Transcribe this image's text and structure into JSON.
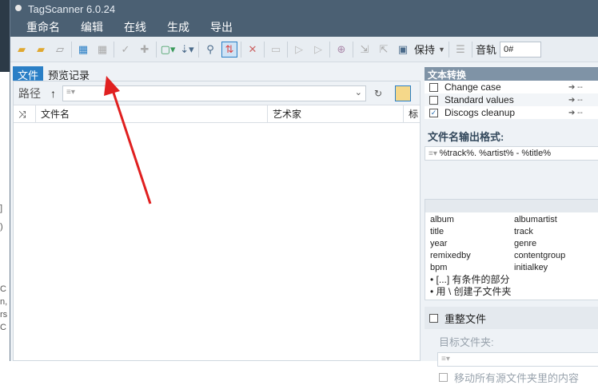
{
  "window": {
    "title": "TagScanner 6.0.24"
  },
  "menu": [
    "重命名",
    "编辑",
    "在线",
    "生成",
    "导出"
  ],
  "toolbar": {
    "keep_label": "保持",
    "track_label": "音轨",
    "track_value": "0#"
  },
  "tabs": [
    {
      "label": "文件"
    },
    {
      "label": "预览记录"
    }
  ],
  "path": {
    "label": "路径",
    "placeholder": "≡▾"
  },
  "columns": [
    "文件名",
    "艺术家",
    "标"
  ],
  "text_conversion": {
    "title": "文本转换",
    "options": [
      {
        "label": "Change case",
        "checked": false
      },
      {
        "label": "Standard values",
        "checked": false
      },
      {
        "label": "Discogs cleanup",
        "checked": true
      }
    ],
    "arrow_value": "--"
  },
  "format": {
    "label": "文件名输出格式:",
    "value": "%track%. %artist% - %title%"
  },
  "fields": [
    "album",
    "albumartist",
    "title",
    "track",
    "year",
    "genre",
    "remixedby",
    "contentgroup",
    "bpm",
    "initialkey"
  ],
  "hints": [
    "• [...] 有条件的部分",
    "• 用 \\ 创建子文件夹"
  ],
  "reorganize": {
    "label": "重整文件",
    "target_label": "目标文件夹:",
    "move_label": "移动所有源文件夹里的内容"
  },
  "left_fragments": [
    "]",
    ")",
    "C",
    "n,",
    "rs",
    "C"
  ]
}
